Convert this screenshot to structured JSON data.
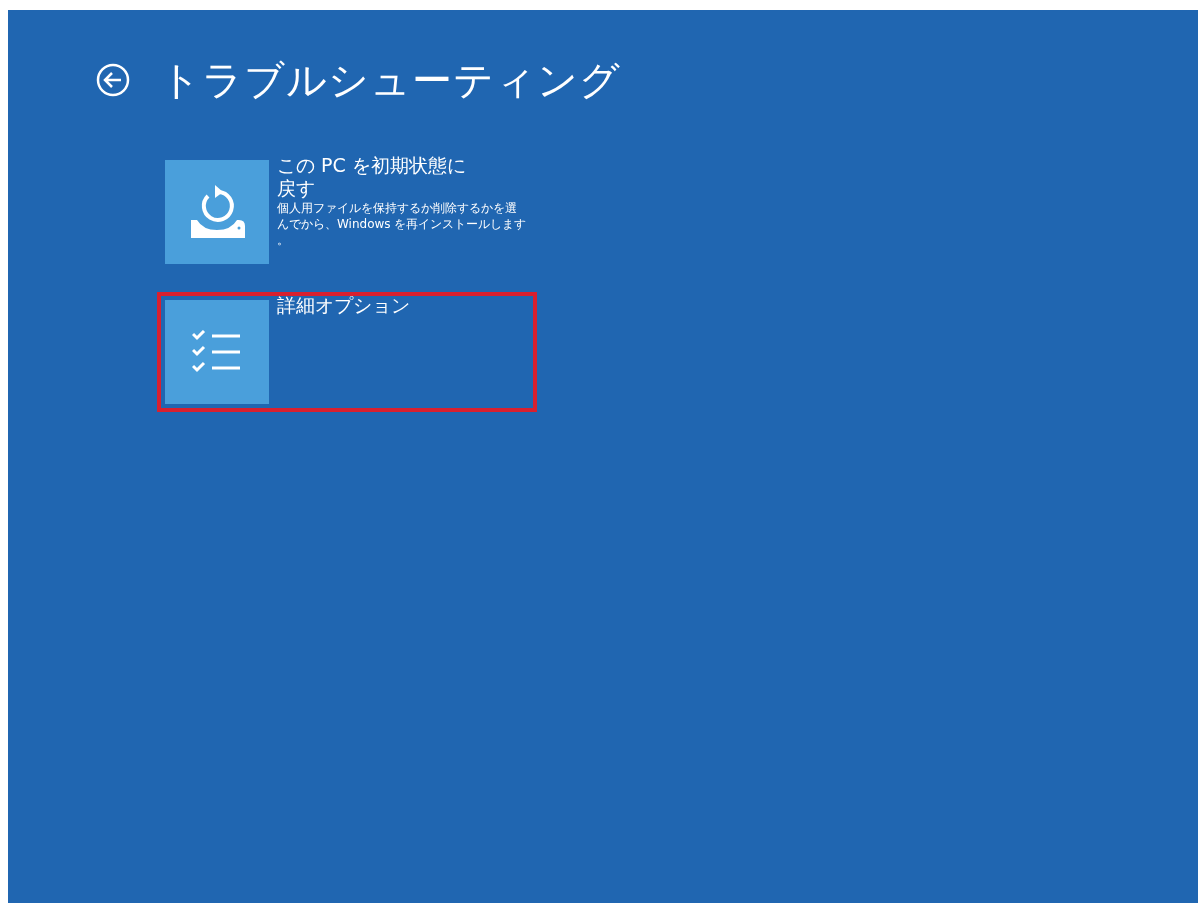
{
  "title": "トラブルシューティング",
  "options": [
    {
      "kind": "reset",
      "title": "この PC を初期状態に戻す",
      "description": "個人用ファイルを保持するか削除するかを選んでから、Windows を再インストールします。",
      "highlighted": false
    },
    {
      "kind": "advanced",
      "title": "詳細オプション",
      "highlighted": true
    }
  ]
}
